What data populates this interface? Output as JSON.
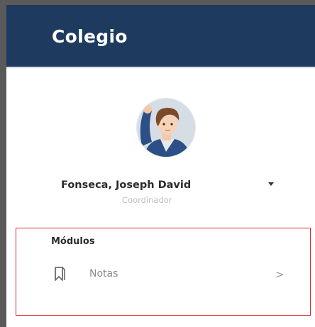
{
  "header": {
    "title": "Colegio"
  },
  "user": {
    "name": "Fonseca, Joseph David",
    "role": "Coordinador",
    "dropdown_icon": "caret-down-icon"
  },
  "modules": {
    "section_label": "Módulos",
    "items": [
      {
        "label": "Notas",
        "icon": "bookmark-icon",
        "chevron": ">"
      }
    ]
  },
  "colors": {
    "header_bg": "#1f3a5f",
    "highlight_border": "#d9262b"
  }
}
